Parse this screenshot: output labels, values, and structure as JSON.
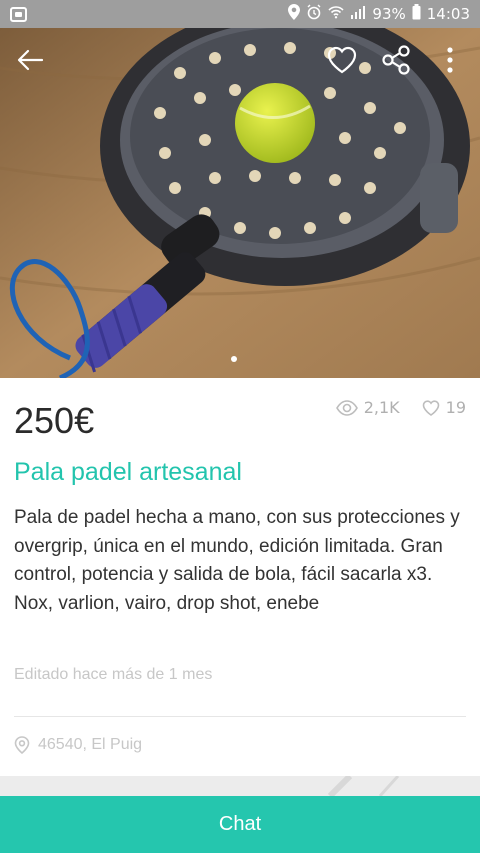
{
  "status_bar": {
    "battery": "93%",
    "time": "14:03"
  },
  "listing": {
    "price": "250€",
    "views": "2,1K",
    "likes": "19",
    "title": "Pala padel artesanal",
    "description": "Pala de padel hecha a mano, con sus protecciones y overgrip, única en el mundo, edición limitada. Gran control, potencia y salida de bola, fácil sacarla x3.  Nox, varlion, vairo, drop shot, enebe",
    "edited": "Editado hace más de 1 mes",
    "location": "46540, El Puig"
  },
  "actions": {
    "chat_label": "Chat"
  },
  "icons": {
    "back": "back-arrow-icon",
    "favorite": "heart-icon",
    "share": "share-icon",
    "more": "more-vert-icon",
    "views": "eye-icon",
    "likes": "heart-outline-icon",
    "location": "location-pin-icon"
  },
  "colors": {
    "accent": "#25c6ae",
    "title": "#23c4ad",
    "status_bar": "#9e9e9e"
  }
}
